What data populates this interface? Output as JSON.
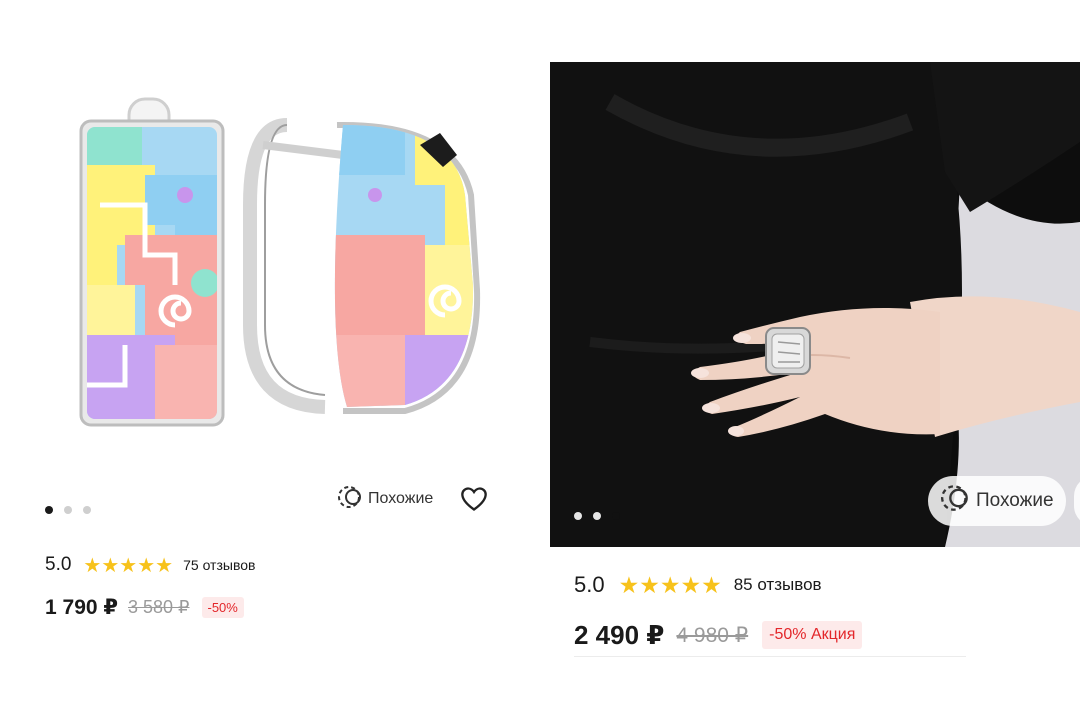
{
  "left_card": {
    "carousel": {
      "count": 3,
      "active": 0
    },
    "similar_label": "Похожие",
    "rating": {
      "score": "5.0",
      "stars": 5,
      "reviews": "75 отзывов"
    },
    "price": {
      "current": "1 790 ₽",
      "old": "3 580 ₽",
      "discount": "-50%"
    }
  },
  "right_card": {
    "carousel": {
      "count": 3,
      "active": 2
    },
    "similar_label": "Похожие",
    "rating": {
      "score": "5.0",
      "stars": 5,
      "reviews": "85 отзывов"
    },
    "price": {
      "current": "2 490 ₽",
      "old": "4 980 ₽",
      "discount": "-50% Акция"
    }
  },
  "colors": {
    "star": "#f7c21b",
    "discount_text": "#e3262a",
    "discount_bg": "#fdeaea"
  }
}
